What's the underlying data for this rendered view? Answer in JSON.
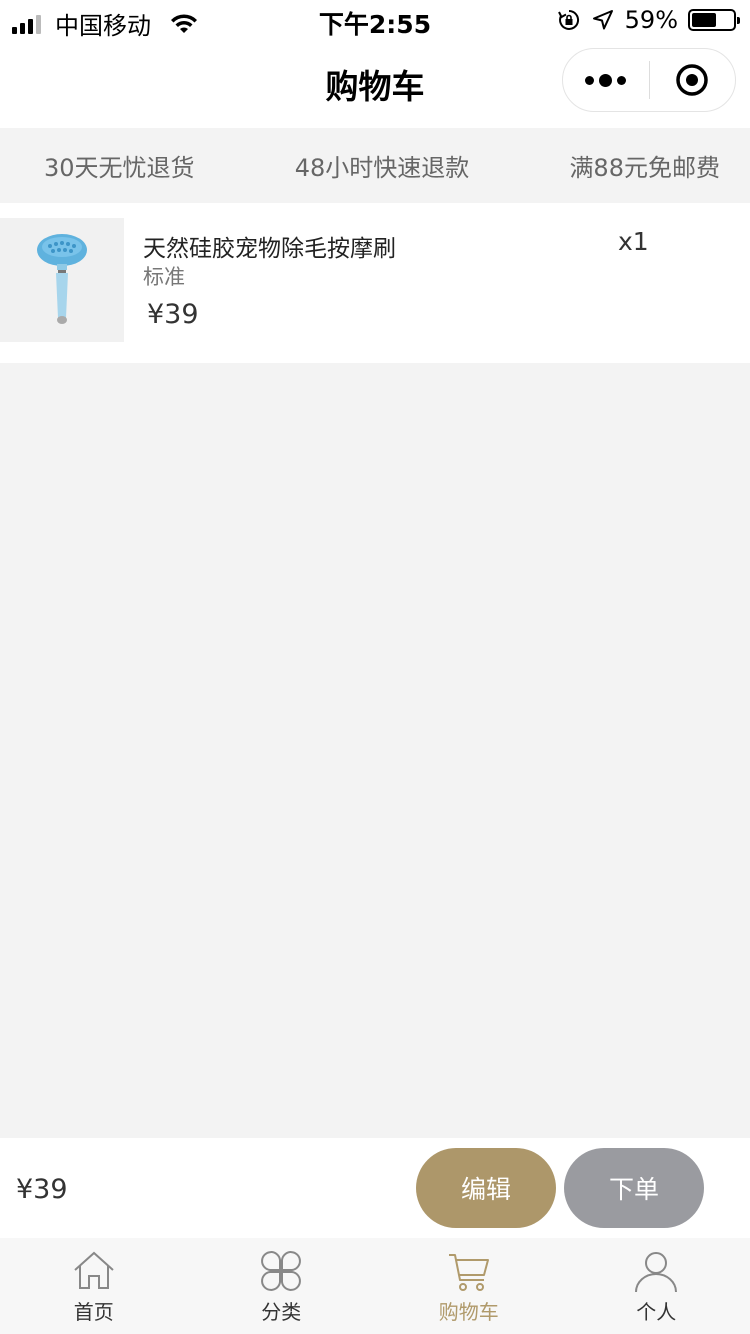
{
  "status_bar": {
    "carrier": "中国移动",
    "time": "下午2:55",
    "battery_percent": "59%",
    "battery_level": 0.59
  },
  "nav": {
    "title": "购物车",
    "more_icon": "ellipsis-icon",
    "close_icon": "target-icon"
  },
  "service": {
    "items": [
      "30天无忧退货",
      "48小时快速退款",
      "满88元免邮费"
    ]
  },
  "cart": {
    "items": [
      {
        "name": "天然硅胶宠物除毛按摩刷",
        "spec": "标准",
        "price": "¥39",
        "quantity": "x1"
      }
    ]
  },
  "checkout": {
    "total": "¥39",
    "edit_label": "编辑",
    "order_label": "下单",
    "edit_color": "#ad976a",
    "order_color": "#9a9ba0"
  },
  "tabbar": {
    "tabs": [
      {
        "label": "首页",
        "icon": "home-icon"
      },
      {
        "label": "分类",
        "icon": "category-icon"
      },
      {
        "label": "购物车",
        "icon": "cart-icon"
      },
      {
        "label": "个人",
        "icon": "person-icon"
      }
    ],
    "active_color": "#b09a6b"
  }
}
